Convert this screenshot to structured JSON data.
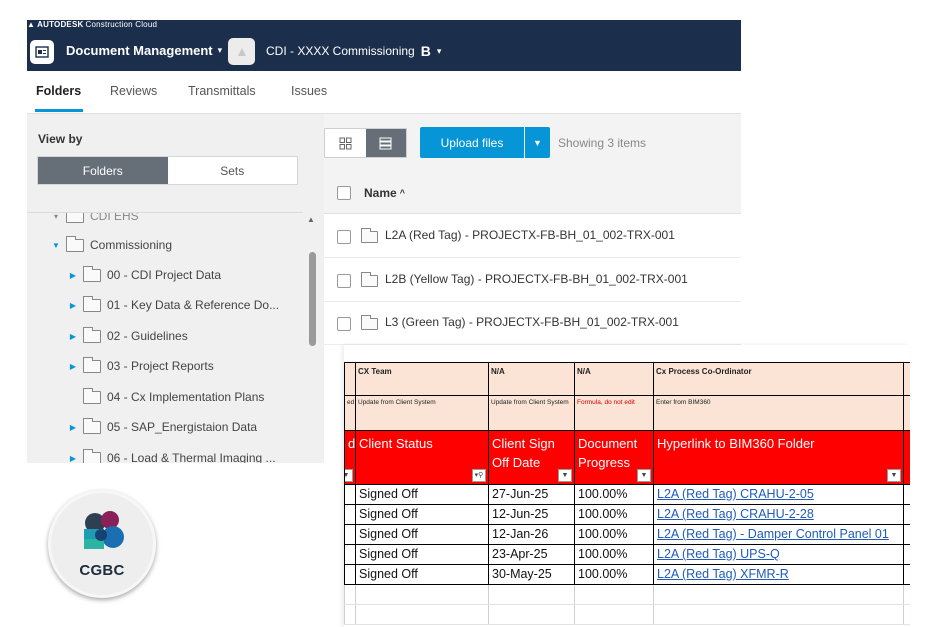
{
  "app": {
    "brand": "AUTODESK",
    "brand_sub": "Construction Cloud",
    "module": "Document Management",
    "project": "CDI - XXXX Commissioning",
    "project_badge": "B"
  },
  "tabs": [
    {
      "label": "Folders",
      "active": true
    },
    {
      "label": "Reviews",
      "active": false
    },
    {
      "label": "Transmittals",
      "active": false
    },
    {
      "label": "Issues",
      "active": false
    }
  ],
  "sidebar": {
    "view_by_label": "View by",
    "view_options": [
      {
        "label": "Folders",
        "active": true
      },
      {
        "label": "Sets",
        "active": false
      }
    ],
    "tree": [
      {
        "label": "CDI EHS",
        "level": 0,
        "expander": "collapsed"
      },
      {
        "label": "Commissioning",
        "level": 0,
        "expander": "expanded"
      },
      {
        "label": "00 - CDI Project Data",
        "level": 1,
        "expander": "collapsed"
      },
      {
        "label": "01 - Key Data & Reference Do...",
        "level": 1,
        "expander": "collapsed"
      },
      {
        "label": "02 - Guidelines",
        "level": 1,
        "expander": "collapsed"
      },
      {
        "label": "03 - Project Reports",
        "level": 1,
        "expander": "collapsed"
      },
      {
        "label": "04 - Cx Implementation Plans",
        "level": 1,
        "expander": "none"
      },
      {
        "label": "05 - SAP_Energistaion Data",
        "level": 1,
        "expander": "collapsed"
      },
      {
        "label": "06 - Load & Thermal Imaging ...",
        "level": 1,
        "expander": "collapsed"
      }
    ]
  },
  "toolbar": {
    "upload_label": "Upload files",
    "showing_text": "Showing 3 items"
  },
  "file_list": {
    "column_name": "Name",
    "items": [
      {
        "name": "L2A (Red Tag) - PROJECTX-FB-BH_01_002-TRX-001"
      },
      {
        "name": "L2B (Yellow Tag) - PROJECTX-FB-BH_01_002-TRX-001"
      },
      {
        "name": "L3 (Green Tag) - PROJECTX-FB-BH_01_002-TRX-001"
      }
    ]
  },
  "spreadsheet": {
    "owner_row": [
      "",
      "CX Team",
      "N/A",
      "N/A",
      "Cx Process Co-Ordinator"
    ],
    "source_row": [
      "ed",
      "Update from Client System",
      "Update from Client System",
      "Formula, do not edit",
      "Enter from BIM360"
    ],
    "header_row": [
      "d",
      "Client Status",
      "Client Sign Off Date",
      "Document Progress",
      "Hyperlink to BIM360 Folder"
    ],
    "rows": [
      {
        "status": "Signed Off",
        "date": "27-Jun-25",
        "progress": "100.00%",
        "link": "L2A (Red Tag) CRAHU-2-05"
      },
      {
        "status": "Signed Off",
        "date": "12-Jun-25",
        "progress": "100.00%",
        "link": "L2A (Red Tag) CRAHU-2-28"
      },
      {
        "status": "Signed Off",
        "date": "12-Jan-26",
        "progress": "100.00%",
        "link": "L2A (Red Tag) - Damper Control Panel 01"
      },
      {
        "status": "Signed Off",
        "date": "23-Apr-25",
        "progress": "100.00%",
        "link": "L2A (Red Tag) UPS-Q"
      },
      {
        "status": "Signed Off",
        "date": "30-May-25",
        "progress": "100.00%",
        "link": "L2A (Red Tag) XFMR-R"
      }
    ]
  },
  "logo": {
    "text": "CGBC"
  },
  "colors": {
    "header_bg": "#1b2f4d",
    "accent": "#0696d7",
    "sheet_header_red": "#ff0000",
    "sheet_peach": "#fbe4d5",
    "link": "#1f5bb8"
  }
}
